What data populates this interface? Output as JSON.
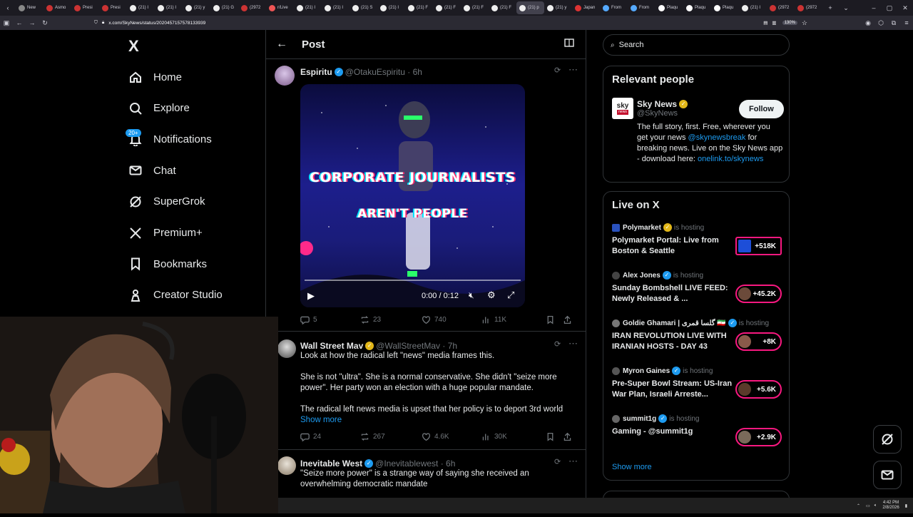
{
  "browser": {
    "tabs": [
      "New",
      "Asmo",
      "Presi",
      "Presi",
      "(21) I",
      "(21) I",
      "(21) y",
      "(21) G",
      "(2972",
      "r/Live",
      "(21) I",
      "(21) I",
      "(21) S",
      "(21) I",
      "(21) F",
      "(21) F",
      "(21) F",
      "(21) F",
      "(21) p",
      "(21) y",
      "Japan",
      "From",
      "From",
      "Plaqu",
      "Plaqu",
      "Plaqu",
      "(21) I",
      "(2972",
      "(2972"
    ],
    "active_tab_index": 18,
    "url": "x.com/SkyNews/status/2020457157578133939",
    "zoom": "130%"
  },
  "sidebar": {
    "logo": "X",
    "items": [
      {
        "label": "Home",
        "icon": "home-icon"
      },
      {
        "label": "Explore",
        "icon": "search-icon"
      },
      {
        "label": "Notifications",
        "icon": "bell-icon",
        "badge": "20+"
      },
      {
        "label": "Chat",
        "icon": "mail-icon"
      },
      {
        "label": "SuperGrok",
        "icon": "grok-icon"
      },
      {
        "label": "Premium+",
        "icon": "x-icon"
      },
      {
        "label": "Bookmarks",
        "icon": "bookmark-icon"
      },
      {
        "label": "Creator Studio",
        "icon": "flask-icon"
      }
    ]
  },
  "post": {
    "header": "Post",
    "author": {
      "name": "Espiritu",
      "handle": "@OtakuEspiritu",
      "time": "6h"
    },
    "video": {
      "line1": "CORPORATE JOURNALISTS",
      "line2": "AREN'T PEOPLE",
      "time": "0:00 / 0:12"
    },
    "stats": {
      "replies": "5",
      "reposts": "23",
      "likes": "740",
      "views": "11K"
    }
  },
  "replies": [
    {
      "name": "Wall Street Mav",
      "handle": "@WallStreetMav",
      "time": "7h",
      "text1": "Look at how the radical left \"news\" media frames this.",
      "text2": "She is not \"ultra\". She is a normal conservative. She didn't \"seize more power\". Her party won an election with a huge popular mandate.",
      "text3": "The radical left news media is upset that her policy is to deport 3rd world",
      "show_more": "Show more",
      "stats": {
        "replies": "24",
        "reposts": "267",
        "likes": "4.6K",
        "views": "30K"
      }
    },
    {
      "name": "Inevitable West",
      "handle": "@Inevitablewest",
      "time": "6h",
      "text1": "\"Seize more power\" is a strange way of saying she received an overwhelming democratic mandate"
    }
  ],
  "right": {
    "search_placeholder": "Search",
    "relevant": {
      "title": "Relevant people",
      "name": "Sky News",
      "handle": "@SkyNews",
      "follow": "Follow",
      "bio1": "The full story, first. Free, wherever you get your news ",
      "bio_link1": "@skynewsbreak",
      "bio2": " for breaking news. Live on the Sky News app - download here: ",
      "bio_link2": "onelink.to/skynews"
    },
    "live": {
      "title": "Live on X",
      "hosting_label": "is hosting",
      "items": [
        {
          "host": "Polymarket",
          "title": "Polymarket Portal: Live from Boston & Seattle",
          "count": "+518K"
        },
        {
          "host": "Alex Jones",
          "title": "Sunday Bombshell LIVE FEED: Newly Released & ...",
          "count": "+45.2K"
        },
        {
          "host": "Goldie Ghamari | گلسا قمری 🇮🇷",
          "title": "IRAN REVOLUTION LIVE WITH IRANIAN HOSTS - DAY 43",
          "count": "+8K"
        },
        {
          "host": "Myron Gaines",
          "title": "Pre-Super Bowl Stream: US-Iran War Plan, Israeli Arreste...",
          "count": "+5.6K"
        },
        {
          "host": "summit1g",
          "title": "Gaming - @summit1g",
          "count": "+2.9K"
        }
      ],
      "show_more": "Show more"
    }
  },
  "taskbar": {
    "time": "4:42 PM",
    "date": "2/8/2026"
  },
  "colors": {
    "accent": "#1d9bf0",
    "live_pink": "#f91880",
    "gold": "#e2b719",
    "border": "#2f3336"
  }
}
